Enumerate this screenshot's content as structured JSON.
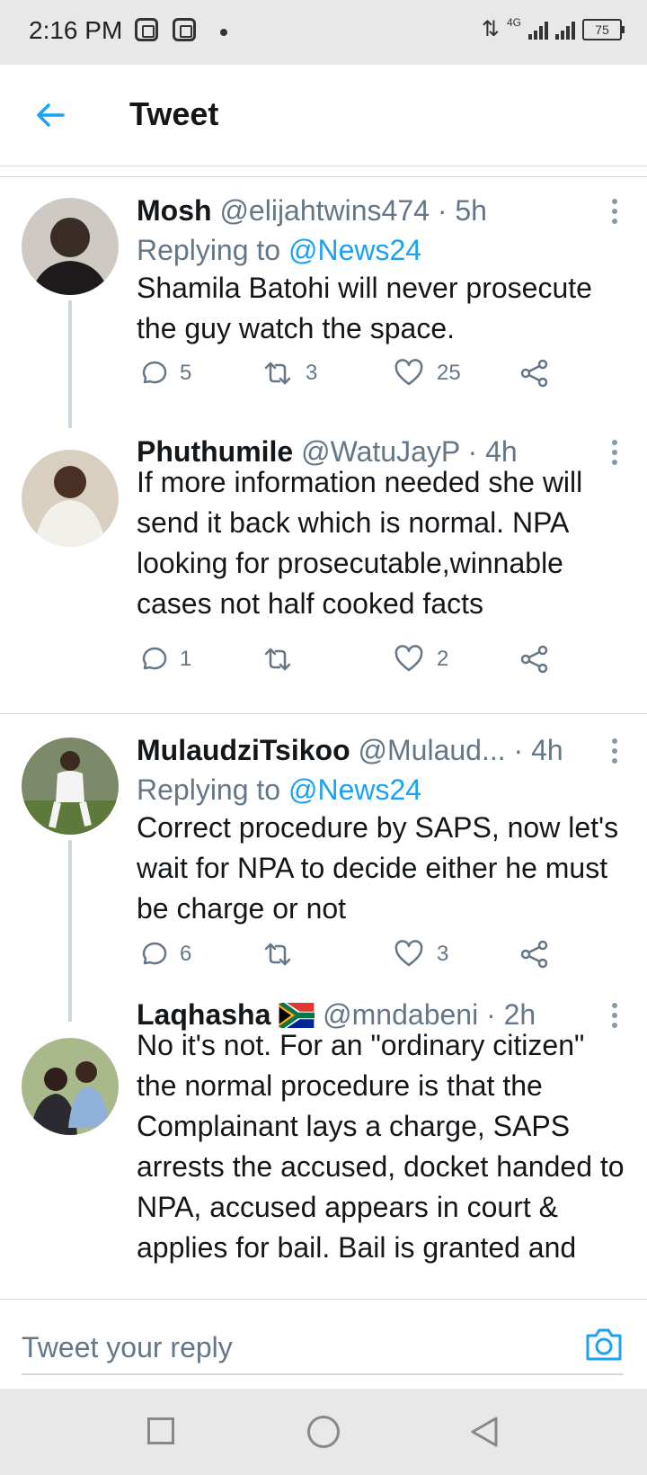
{
  "status_bar": {
    "time": "2:16 PM",
    "network": "4G",
    "battery": "75"
  },
  "header": {
    "title": "Tweet",
    "back_icon": "arrow-left-icon"
  },
  "colors": {
    "accent": "#1da1f2",
    "secondary_text": "#657786",
    "primary_text": "#14171a",
    "divider": "#cfd9de"
  },
  "tweets": [
    {
      "name": "Mosh",
      "handle": "@elijahtwins474",
      "time": "· 5h",
      "replying_prefix": "Replying to ",
      "replying_to": "@News24",
      "body": "Shamila Batohi will never prosecute the guy watch the space.",
      "replies": "5",
      "retweets": "3",
      "likes": "25"
    },
    {
      "name": "Phuthumile",
      "handle": "@WatuJayP",
      "time": "· 4h",
      "body": "If more information needed she will send it back which is normal. NPA looking for prosecutable,winnable cases not half cooked facts",
      "replies": "1",
      "retweets": "",
      "likes": "2"
    },
    {
      "name": "MulaudziTsikoo",
      "handle": "@Mulaud...",
      "time": "· 4h",
      "replying_prefix": "Replying to ",
      "replying_to": "@News24",
      "body": "Correct procedure by SAPS, now let's wait for NPA to decide either he must be charge or not",
      "replies": "6",
      "retweets": "",
      "likes": "3"
    },
    {
      "name": "Laqhasha",
      "handle": "@mndabeni",
      "time": "· 2h",
      "flag_icon": "south-africa-flag-icon",
      "body": "No it's not. For an \"ordinary citizen\" the normal procedure is that the Complainant lays a charge, SAPS arrests the accused, docket handed to NPA, accused appears in court & applies for bail. Bail is granted and"
    }
  ],
  "reply_bar": {
    "placeholder": "Tweet your reply",
    "camera_icon": "camera-icon"
  },
  "nav_bar": {
    "recents_icon": "square-icon",
    "home_icon": "circle-icon",
    "back_icon": "triangle-back-icon"
  }
}
